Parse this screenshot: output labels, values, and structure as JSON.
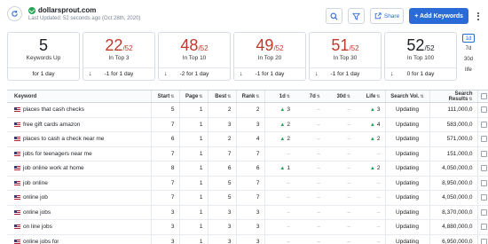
{
  "header": {
    "site_name": "dollarsprout.com",
    "updated": "Last Updated: 52 seconds ago (Oct 28th, 2020)",
    "share_label": "Share",
    "add_keywords_label": "+ Add Keywords"
  },
  "cards": [
    {
      "big": "5",
      "den": "",
      "label": "Keywords Up",
      "foot": "for 1 day",
      "arrow": ""
    },
    {
      "big": "22",
      "den": "/52",
      "label": "In Top 3",
      "foot": "-1 for 1 day",
      "arrow": "↓"
    },
    {
      "big": "48",
      "den": "/52",
      "label": "In Top 10",
      "foot": "-2 for 1 day",
      "arrow": "↓"
    },
    {
      "big": "49",
      "den": "/52",
      "label": "In Top 20",
      "foot": "-1 for 1 day",
      "arrow": "↓"
    },
    {
      "big": "51",
      "den": "/52",
      "label": "In Top 30",
      "foot": "-1 for 1 day",
      "arrow": "↓"
    },
    {
      "big": "52",
      "den": "/52",
      "label": "In Top 100",
      "foot": "0 for 1 day",
      "arrow": "↓"
    }
  ],
  "periods": [
    "1d",
    "7d",
    "30d",
    "life"
  ],
  "table": {
    "headers": [
      "Keyword",
      "Start",
      "Page",
      "Best",
      "Rank",
      "1d",
      "7d",
      "30d",
      "Life",
      "Search Vol.",
      "Search Results"
    ],
    "rows": [
      {
        "keyword": "places that cash checks",
        "start": "5",
        "page": "1",
        "best": "2",
        "rank": "2",
        "d1": "3",
        "d1_up": true,
        "d7": "–",
        "d30": "–",
        "life": "3",
        "life_up": true,
        "vol": "Updating",
        "results": "111,000,0"
      },
      {
        "keyword": "free gift cards amazon",
        "start": "7",
        "page": "1",
        "best": "3",
        "rank": "3",
        "d1": "2",
        "d1_up": true,
        "d7": "–",
        "d30": "–",
        "life": "4",
        "life_up": true,
        "vol": "Updating",
        "results": "583,000,0"
      },
      {
        "keyword": "places to cash a check near me",
        "start": "6",
        "page": "1",
        "best": "2",
        "rank": "4",
        "d1": "2",
        "d1_up": true,
        "d7": "–",
        "d30": "–",
        "life": "2",
        "life_up": true,
        "vol": "Updating",
        "results": "571,000,0"
      },
      {
        "keyword": "jobs for teenagers near me",
        "start": "7",
        "page": "1",
        "best": "7",
        "rank": "7",
        "d1": "–",
        "d1_up": false,
        "d7": "–",
        "d30": "–",
        "life": "–",
        "life_up": false,
        "vol": "Updating",
        "results": "151,000,0"
      },
      {
        "keyword": "job online work at home",
        "start": "8",
        "page": "1",
        "best": "6",
        "rank": "6",
        "d1": "1",
        "d1_up": true,
        "d7": "–",
        "d30": "–",
        "life": "2",
        "life_up": true,
        "vol": "Updating",
        "results": "4,050,000,0"
      },
      {
        "keyword": "job online",
        "start": "7",
        "page": "1",
        "best": "5",
        "rank": "7",
        "d1": "–",
        "d1_up": false,
        "d7": "–",
        "d30": "–",
        "life": "–",
        "life_up": false,
        "vol": "Updating",
        "results": "8,950,000,0"
      },
      {
        "keyword": "online job",
        "start": "7",
        "page": "1",
        "best": "5",
        "rank": "7",
        "d1": "–",
        "d1_up": false,
        "d7": "–",
        "d30": "–",
        "life": "–",
        "life_up": false,
        "vol": "Updating",
        "results": "4,050,000,0"
      },
      {
        "keyword": "online jobs",
        "start": "3",
        "page": "1",
        "best": "3",
        "rank": "3",
        "d1": "–",
        "d1_up": false,
        "d7": "–",
        "d30": "–",
        "life": "–",
        "life_up": false,
        "vol": "Updating",
        "results": "8,370,000,0"
      },
      {
        "keyword": "on line jobs",
        "start": "3",
        "page": "1",
        "best": "3",
        "rank": "3",
        "d1": "–",
        "d1_up": false,
        "d7": "–",
        "d30": "–",
        "life": "–",
        "life_up": false,
        "vol": "Updating",
        "results": "4,880,000,0"
      },
      {
        "keyword": "online jobs for",
        "start": "3",
        "page": "1",
        "best": "3",
        "rank": "3",
        "d1": "–",
        "d1_up": false,
        "d7": "–",
        "d30": "–",
        "life": "–",
        "life_up": false,
        "vol": "Updating",
        "results": "6,950,000,0"
      }
    ]
  },
  "colors": {
    "accent": "#2a6bd8",
    "red": "#c0392b",
    "green": "#23a455"
  }
}
